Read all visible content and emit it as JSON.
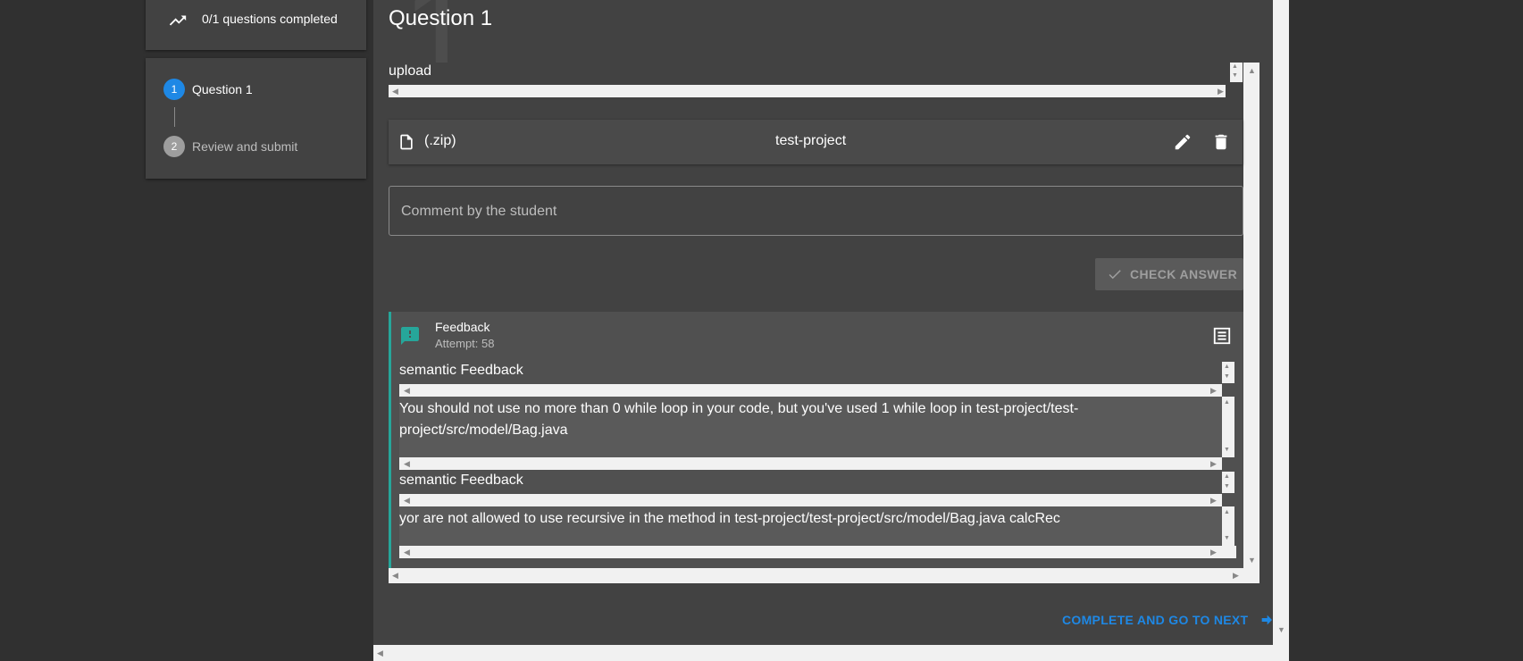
{
  "progress": {
    "text": "0/1 questions completed",
    "icon": "trending-up-icon"
  },
  "stepper": {
    "steps": [
      {
        "number": "1",
        "label": "Question 1",
        "active": true,
        "color": "#1e88e5"
      },
      {
        "number": "2",
        "label": "Review and submit",
        "active": false,
        "color": "#9e9e9e"
      }
    ]
  },
  "question": {
    "numeral": "1",
    "title": "Question 1",
    "upload_label": "upload",
    "file": {
      "extension": "(.zip)",
      "name": "test-project",
      "icons": [
        "file-icon",
        "edit-icon",
        "delete-icon"
      ]
    },
    "comment_placeholder": "Comment by the student",
    "check_answer_label": "CHECK ANSWER"
  },
  "feedback": {
    "title": "Feedback",
    "attempt": "Attempt: 58",
    "accent": "#26a69a",
    "items": [
      {
        "label": "semantic Feedback",
        "text": "You should not use no more than 0 while loop in your code, but you've used 1 while loop in test-project/test-project/src/model/Bag.java"
      },
      {
        "label": "semantic Feedback",
        "text": "yor are not allowed to use recursive in the method in test-project/test-project/src/model/Bag.java calcRec"
      }
    ]
  },
  "footer": {
    "next_label": "COMPLETE AND GO TO NEXT",
    "accent": "#1e88e5"
  }
}
